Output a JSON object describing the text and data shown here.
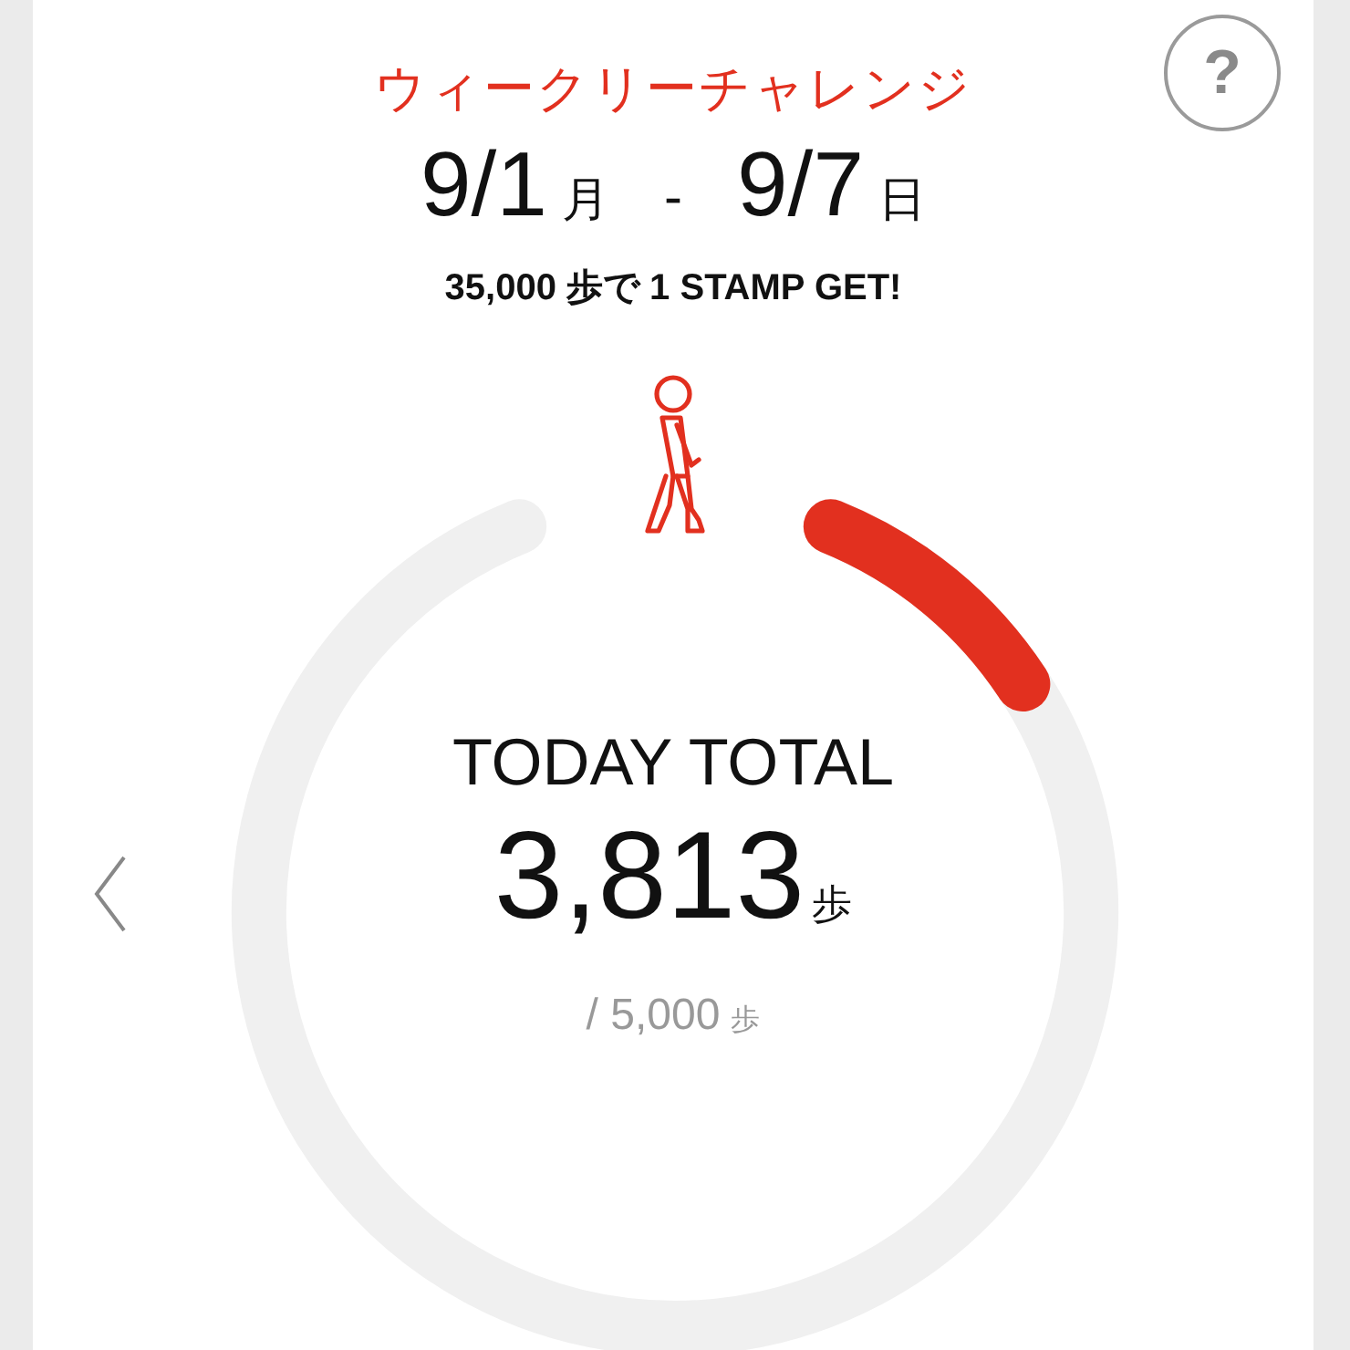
{
  "header": {
    "title": "ウィークリーチャレンジ",
    "start_date": "9/1",
    "start_unit": "月",
    "separator": "-",
    "end_date": "9/7",
    "end_unit": "日",
    "goal": "35,000 歩で 1 STAMP GET!"
  },
  "help_button": {
    "label": "?"
  },
  "today": {
    "label": "TODAY TOTAL",
    "steps": "3,813",
    "steps_unit": "歩",
    "target": "/ 5,000",
    "target_unit": "歩"
  }
}
